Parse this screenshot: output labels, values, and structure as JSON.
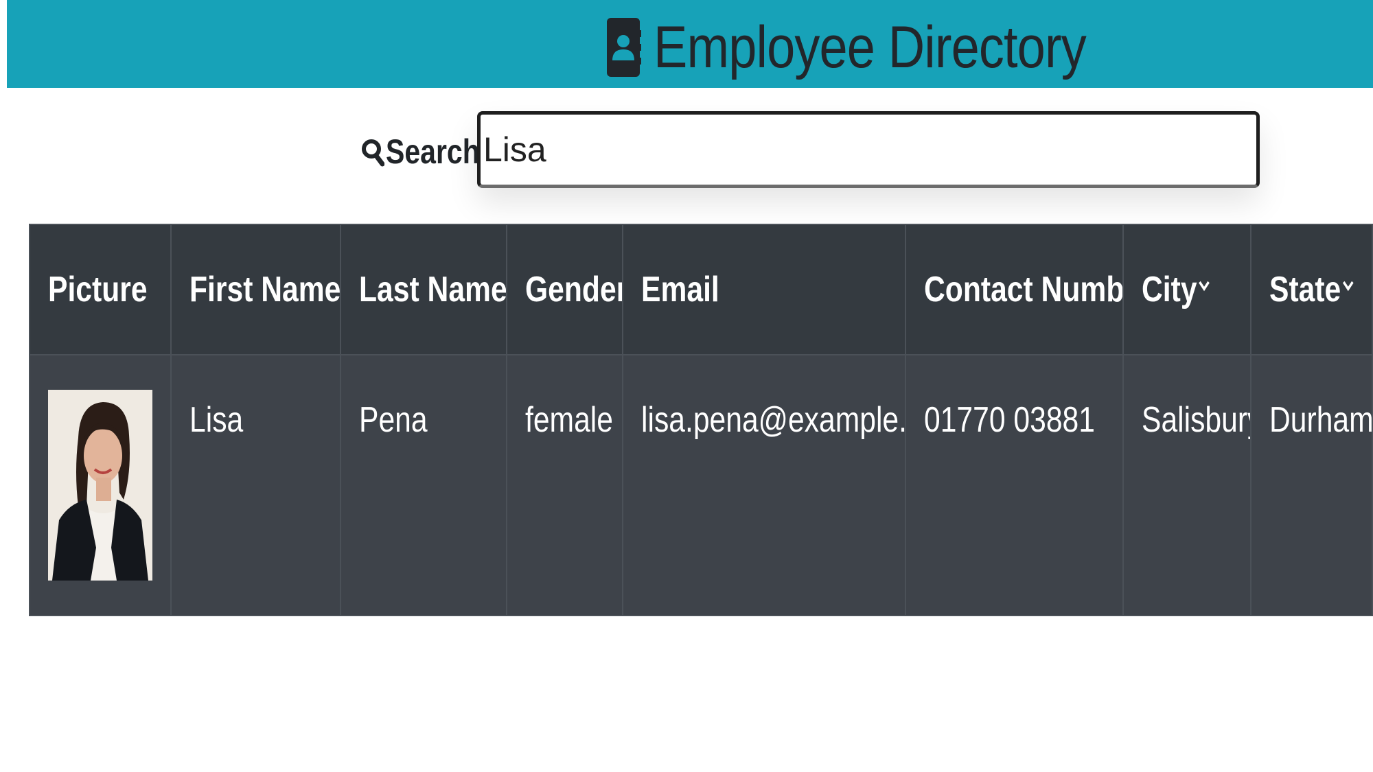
{
  "header": {
    "title": "Employee Directory",
    "icon": "address-book-icon",
    "background": "#17a2b8"
  },
  "search": {
    "label": "Search:",
    "icon": "search-icon",
    "value": "Lisa"
  },
  "table": {
    "header_background": "#343a40",
    "body_background": "#3e434a",
    "columns": [
      {
        "label": "Picture",
        "sortable": false
      },
      {
        "label": "First Name",
        "sortable": true
      },
      {
        "label": "Last Name",
        "sortable": true
      },
      {
        "label": "Gender",
        "sortable": false
      },
      {
        "label": "Email",
        "sortable": false
      },
      {
        "label": "Contact Number",
        "sortable": false
      },
      {
        "label": "City",
        "sortable": true
      },
      {
        "label": "State",
        "sortable": true
      }
    ],
    "rows": [
      {
        "picture": "employee-portrait",
        "first_name": "Lisa",
        "last_name": "Pena",
        "gender": "female",
        "email": "lisa.pena@example.com",
        "contact_number": "01770 03881",
        "city": "Salisbury",
        "state": "Durham"
      }
    ]
  }
}
